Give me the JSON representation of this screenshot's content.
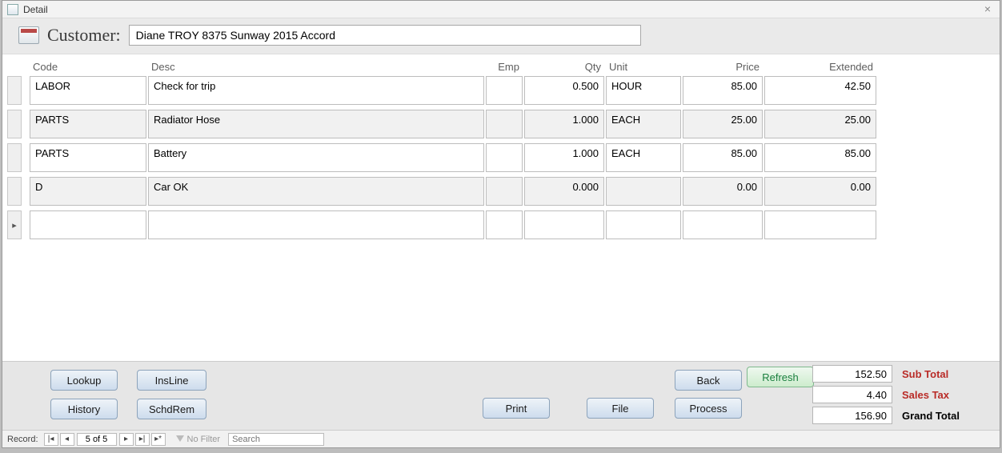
{
  "window": {
    "title": "Detail",
    "close_symbol": "×"
  },
  "customer": {
    "label": "Customer:",
    "value": "Diane TROY 8375 Sunway 2015 Accord"
  },
  "headers": {
    "code": "Code",
    "desc": "Desc",
    "emp": "Emp",
    "qty": "Qty",
    "unit": "Unit",
    "price": "Price",
    "extended": "Extended"
  },
  "rows": [
    {
      "code": "LABOR",
      "desc": "Check for trip",
      "emp": "",
      "qty": "0.500",
      "unit": "HOUR",
      "price": "85.00",
      "extended": "42.50",
      "alt": false
    },
    {
      "code": "PARTS",
      "desc": "Radiator Hose",
      "emp": "",
      "qty": "1.000",
      "unit": "EACH",
      "price": "25.00",
      "extended": "25.00",
      "alt": true
    },
    {
      "code": "PARTS",
      "desc": "Battery",
      "emp": "",
      "qty": "1.000",
      "unit": "EACH",
      "price": "85.00",
      "extended": "85.00",
      "alt": false
    },
    {
      "code": "D",
      "desc": "Car OK",
      "emp": "",
      "qty": "0.000",
      "unit": "",
      "price": "0.00",
      "extended": "0.00",
      "alt": true
    },
    {
      "code": "",
      "desc": "",
      "emp": "",
      "qty": "",
      "unit": "",
      "price": "",
      "extended": "",
      "alt": false,
      "new": true
    }
  ],
  "buttons": {
    "lookup": "Lookup",
    "insline": "InsLine",
    "history": "History",
    "schdrem": "SchdRem",
    "print": "Print",
    "file": "File",
    "back": "Back",
    "process": "Process",
    "refresh": "Refresh"
  },
  "totals": {
    "subtotal_label": "Sub Total",
    "subtotal": "152.50",
    "salestax_label": "Sales Tax",
    "salestax": "4.40",
    "grand_label": "Grand Total",
    "grand": "156.90"
  },
  "recnav": {
    "record_label": "Record:",
    "first": "|◂",
    "prev": "◂",
    "next": "▸",
    "last": "▸|",
    "new": "▸*",
    "position": "5 of 5",
    "nofilter": "No Filter",
    "search_placeholder": "Search"
  }
}
